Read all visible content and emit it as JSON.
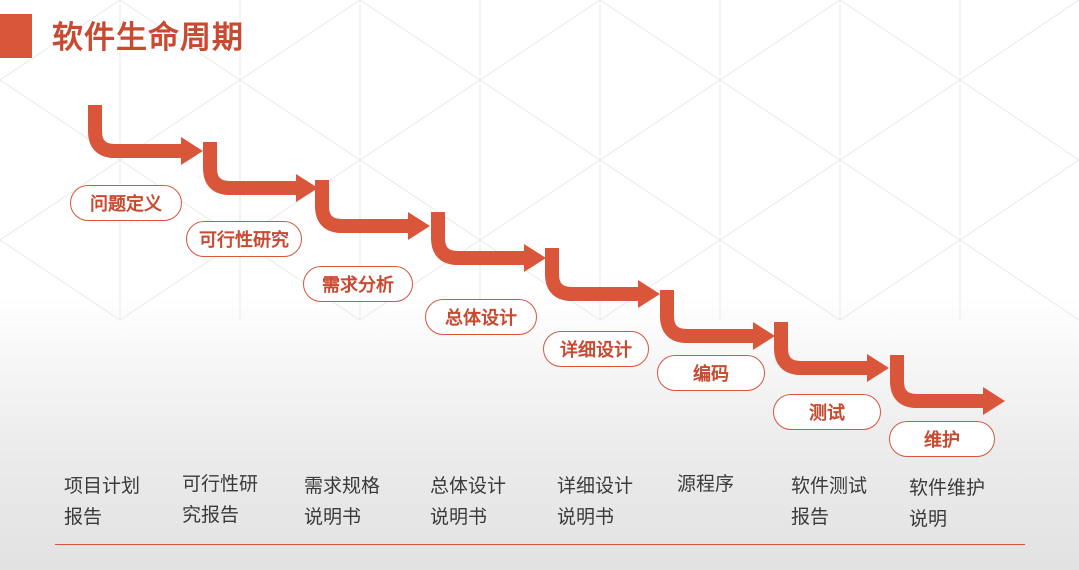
{
  "title": "软件生命周期",
  "colors": {
    "accent": "#d9563a",
    "title": "#c84a30",
    "text": "#3a3a3a"
  },
  "steps": [
    {
      "label": "问题定义"
    },
    {
      "label": "可行性研究"
    },
    {
      "label": "需求分析"
    },
    {
      "label": "总体设计"
    },
    {
      "label": "详细设计"
    },
    {
      "label": "编码"
    },
    {
      "label": "测试"
    },
    {
      "label": "维护"
    }
  ],
  "deliverables": [
    {
      "line1": "项目计划",
      "line2": "报告"
    },
    {
      "line1": "可行性研",
      "line2": "究报告"
    },
    {
      "line1": "需求规格",
      "line2": "说明书"
    },
    {
      "line1": "总体设计",
      "line2": "说明书"
    },
    {
      "line1": "详细设计",
      "line2": "说明书"
    },
    {
      "line1": "源程序",
      "line2": ""
    },
    {
      "line1": "软件测试",
      "line2": "报告"
    },
    {
      "line1": "软件维护",
      "line2": "说明"
    }
  ]
}
